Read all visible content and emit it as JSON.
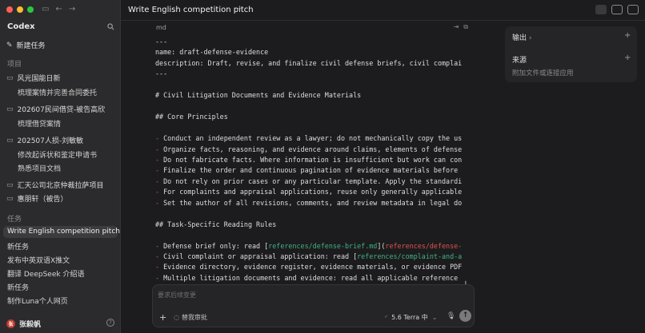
{
  "sidebar": {
    "app_title": "Codex",
    "new_task": "新建任务",
    "projects_label": "项目",
    "projects": [
      {
        "name": "风光国能日新",
        "subs": [
          "梳理案情并完善合同委托"
        ]
      },
      {
        "name": "202607民间借贷-被告高欣",
        "subs": [
          "梳理借贷案情"
        ]
      },
      {
        "name": "202507人损-刘敏敏",
        "subs": [
          "修改起诉状和鉴定申请书",
          "熟悉项目文档"
        ]
      },
      {
        "name": "汇天公司北京仲裁拉萨项目",
        "subs": []
      },
      {
        "name": "惠朋轩（被告）",
        "subs": []
      }
    ],
    "tasks_label": "任务",
    "tasks": [
      "Write English competition pitch",
      "新任务",
      "发布中英双语X推文",
      "翻译 DeepSeek 介绍语",
      "新任务",
      "制作Luna个人网页"
    ],
    "user_name": "张毅帆",
    "avatar_text": "张"
  },
  "header": {
    "thread_title": "Write English competition pitch",
    "more": "···"
  },
  "document": {
    "lang": "md",
    "lines": [
      "---",
      "name: draft-defense-evidence",
      "description: Draft, revise, and finalize civil defense briefs, civil complai",
      "---",
      "",
      "# Civil Litigation Documents and Evidence Materials",
      "",
      "## Core Principles",
      "",
      "- Conduct an independent review as a lawyer; do not mechanically copy the us",
      "- Organize facts, reasoning, and evidence around claims, elements of defense",
      "- Do not fabricate facts. Where information is insufficient but work can con",
      "- Finalize the order and continuous pagination of evidence materials before",
      "- Do not rely on prior cases or any particular template. Apply the standardi",
      "- For complaints and appraisal applications, reuse only generally applicable",
      "- Set the author of all revisions, comments, and review metadata in legal do",
      "",
      "## Task-Specific Reading Rules",
      "",
      "- Defense brief only: read [references/defense-brief.md](references/defense-",
      "- Civil complaint or appraisal application: read [references/complaint-and-a",
      "- Evidence directory, evidence register, evidence materials, or evidence PDF",
      "- Multiple litigation documents and evidence: read all applicable reference"
    ],
    "link1_label": "references/defense-brief.md",
    "link1_target": "references/defense-",
    "link2_label": "references/complaint-and-a"
  },
  "composer": {
    "placeholder": "要求后续变更",
    "approval": "替我审批",
    "model": "5.6 Terra 中"
  },
  "right_panel": {
    "output_label": "输出",
    "source_label": "来源",
    "source_hint": "附加文件或连接应用"
  },
  "colors": {
    "accent_red": "#e0524d",
    "link_green": "#3fb37f"
  }
}
